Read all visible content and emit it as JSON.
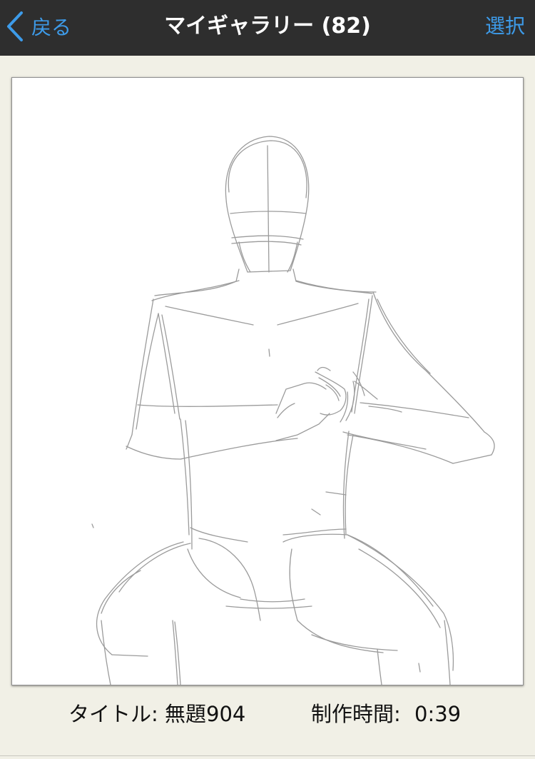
{
  "navbar": {
    "back_label": "戻る",
    "title": "マイギャラリー (82)",
    "select_label": "選択",
    "accent_color": "#3d9be9",
    "background_color": "#2e2e2e"
  },
  "artwork": {
    "kind": "pencil-sketch",
    "icon": "figure-sketch"
  },
  "footer": {
    "title_label": "タイトル:",
    "title_value": "無題904",
    "time_label": "制作時間:",
    "time_value": "0:39"
  }
}
